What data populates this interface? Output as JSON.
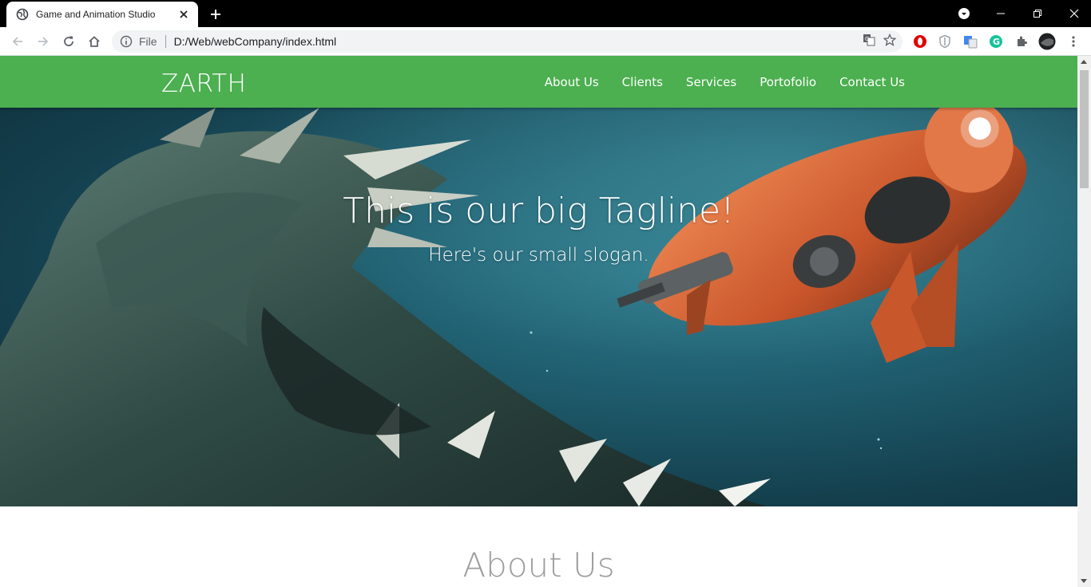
{
  "browser": {
    "tab_title": "Game and Animation Studio",
    "url_scheme": "File",
    "url": "D:/Web/webCompany/index.html"
  },
  "site": {
    "brand": "ZARTH",
    "nav": [
      {
        "label": "About Us"
      },
      {
        "label": "Clients"
      },
      {
        "label": "Services"
      },
      {
        "label": "Portofolio"
      },
      {
        "label": "Contact Us"
      }
    ],
    "hero": {
      "tagline": "This is our big Tagline!",
      "slogan": "Here's our small slogan."
    },
    "about_title": "About Us"
  },
  "colors": {
    "nav_bg": "#4caf50",
    "heading_gray": "#9e9e9e"
  }
}
